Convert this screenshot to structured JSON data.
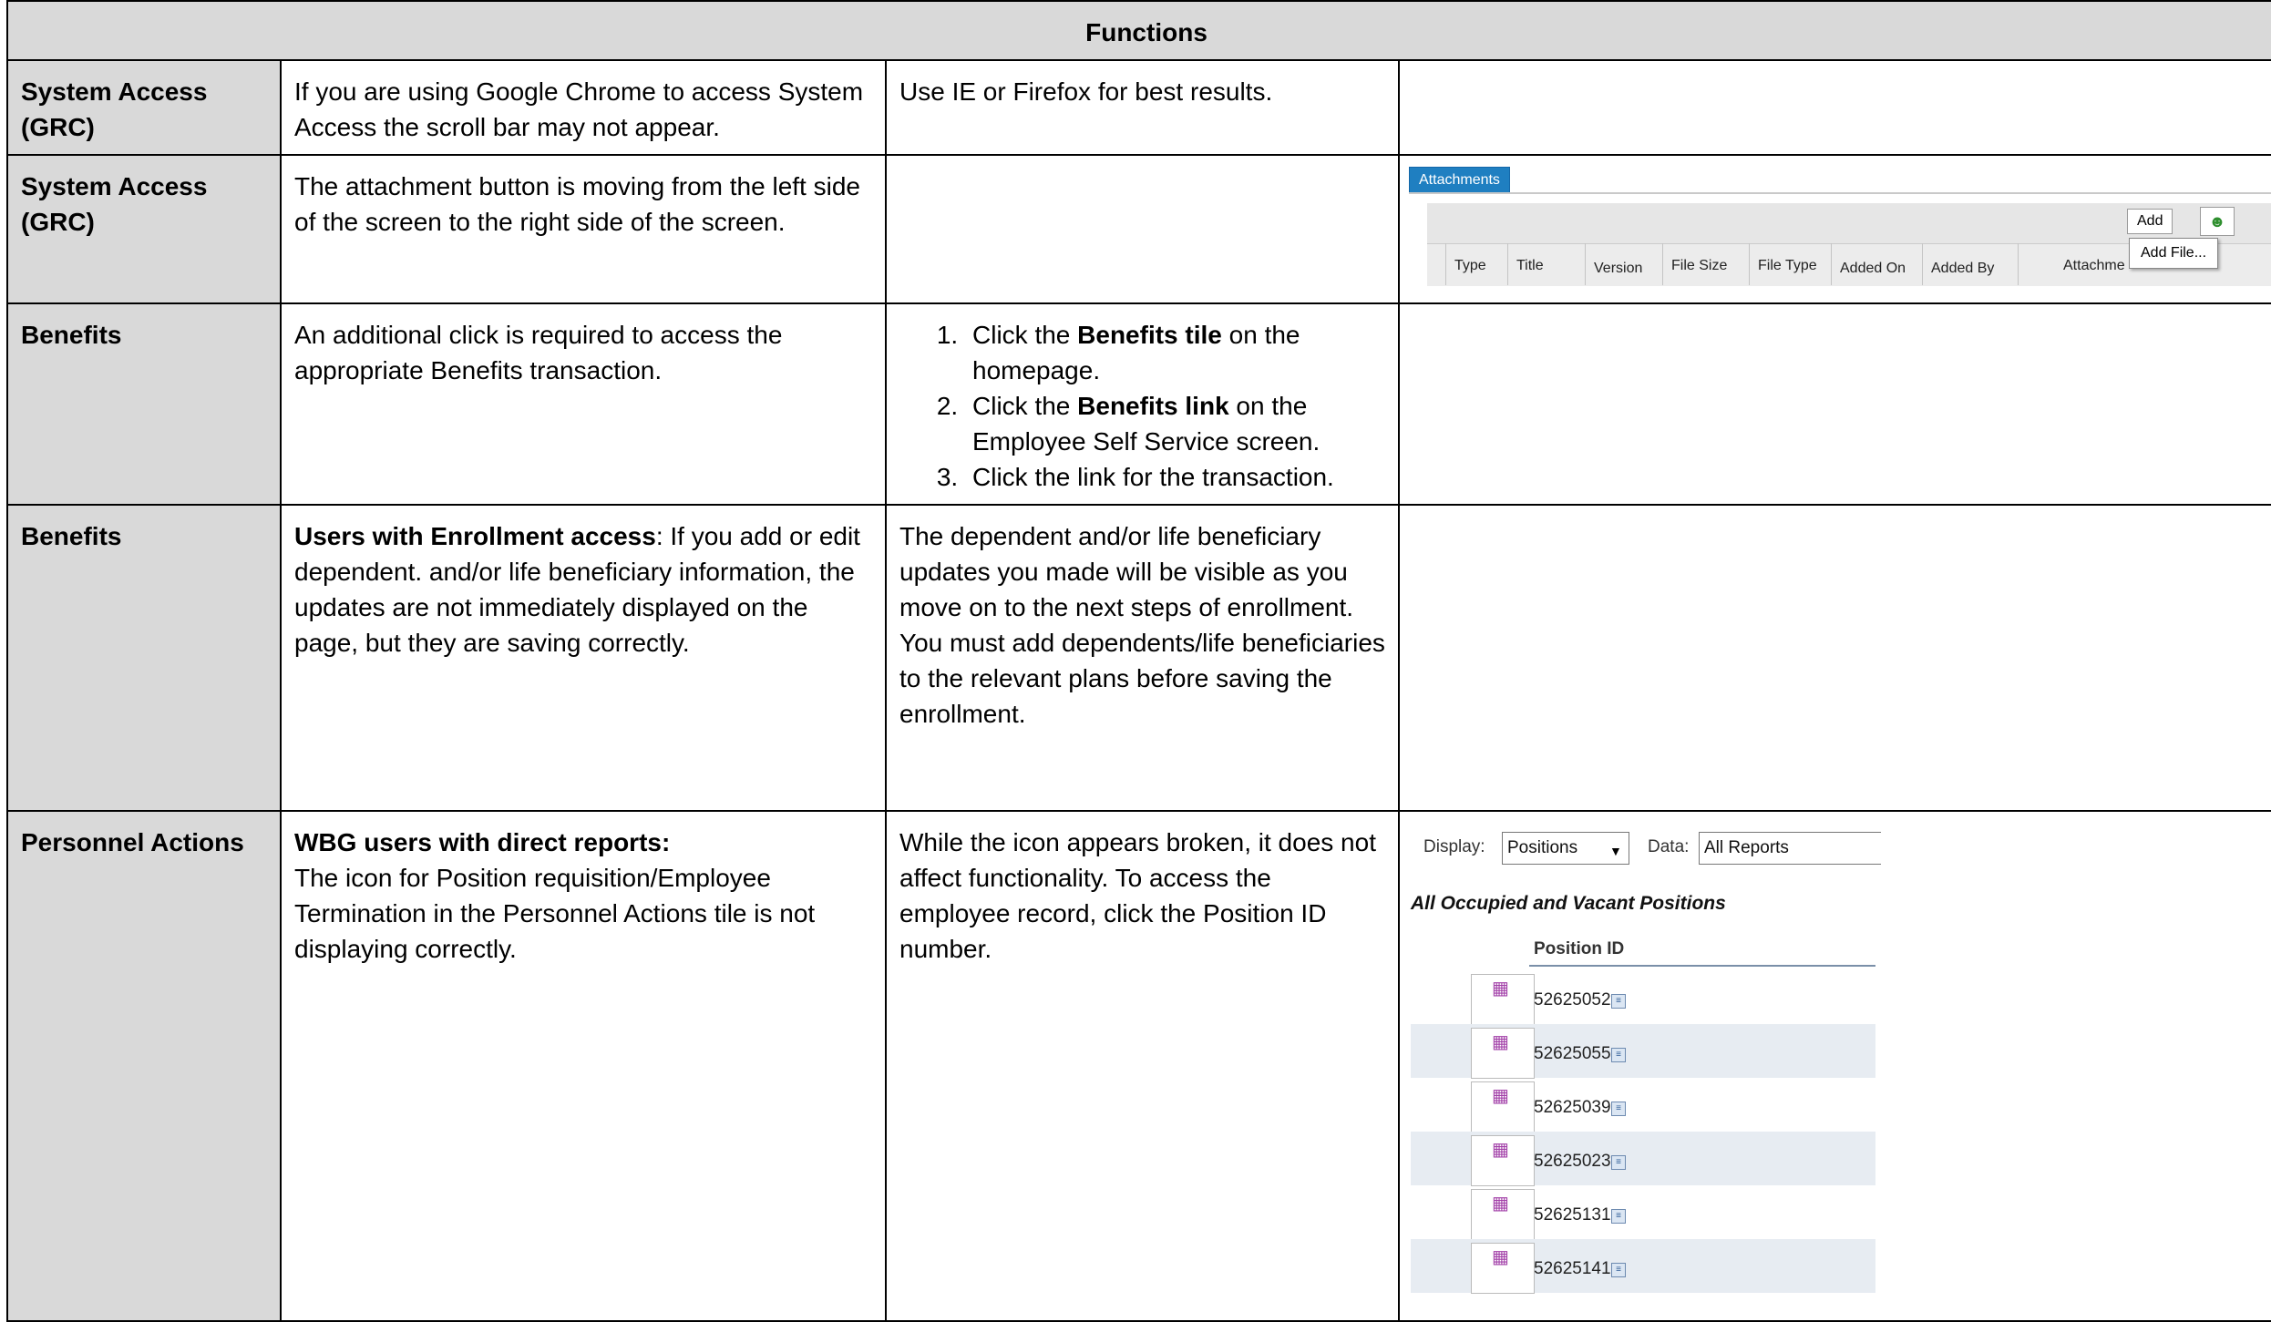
{
  "header": {
    "title": "Functions"
  },
  "rows": [
    {
      "function": "System Access (GRC)",
      "issue": "If you are using Google Chrome to access System Access the scroll bar may not appear.",
      "workaround": "Use IE or Firefox for best results."
    },
    {
      "function": "System Access (GRC)",
      "issue": "The attachment button is moving from the left side of the screen to the right side of the screen.",
      "workaround": ""
    },
    {
      "function": "Benefits",
      "issue": "An additional click is required to access the appropriate Benefits transaction.",
      "steps": [
        {
          "pre": "Click the ",
          "bold": "Benefits tile",
          "post": " on the homepage."
        },
        {
          "pre": "Click the ",
          "bold": "Benefits link",
          "post": " on the Employee Self Service screen."
        },
        {
          "pre": "Click the link for the transaction.",
          "bold": "",
          "post": ""
        }
      ]
    },
    {
      "function": "Benefits",
      "issue_bold": "Users with Enrollment access",
      "issue": ": If you add or edit dependent. and/or life beneficiary information, the updates are not immediately displayed on the page, but they are saving correctly.",
      "workaround": "The dependent and/or life beneficiary updates you made will be visible as you move on to the next steps of enrollment. You must add dependents/life beneficiaries to the relevant plans before saving the enrollment."
    },
    {
      "function": "Personnel Actions",
      "issue_bold": "WBG users with direct reports:",
      "issue": "The icon for Position requisition/Employee Termination in the Personnel Actions tile is not displaying correctly.",
      "workaround": "While the icon appears broken, it does not affect functionality. To access the employee record, click the Position ID number."
    }
  ],
  "attachments_shot": {
    "tab": "Attachments",
    "add_button": "Add",
    "add_menu_item": "Add File...",
    "columns": [
      "Type",
      "Title",
      "Version",
      "File Size",
      "File Type",
      "Added On",
      "Added By",
      "Attachme"
    ]
  },
  "positions_shot": {
    "display_label": "Display:",
    "display_value": "Positions",
    "data_label": "Data:",
    "data_value": "All Reports",
    "title": "All Occupied and Vacant Positions",
    "column": "Position ID",
    "ids": [
      "52625052",
      "52625055",
      "52625039",
      "52625023",
      "52625131",
      "52625141"
    ]
  }
}
